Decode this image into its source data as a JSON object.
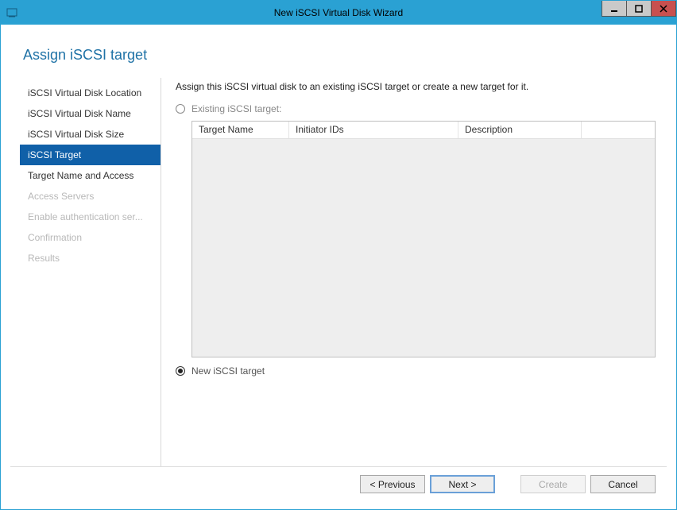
{
  "window": {
    "title": "New iSCSI Virtual Disk Wizard"
  },
  "heading": "Assign iSCSI target",
  "sidebar": {
    "items": [
      {
        "label": "iSCSI Virtual Disk Location",
        "state": "enabled"
      },
      {
        "label": "iSCSI Virtual Disk Name",
        "state": "enabled"
      },
      {
        "label": "iSCSI Virtual Disk Size",
        "state": "enabled"
      },
      {
        "label": "iSCSI Target",
        "state": "selected"
      },
      {
        "label": "Target Name and Access",
        "state": "enabled"
      },
      {
        "label": "Access Servers",
        "state": "disabled"
      },
      {
        "label": "Enable authentication ser...",
        "state": "disabled"
      },
      {
        "label": "Confirmation",
        "state": "disabled"
      },
      {
        "label": "Results",
        "state": "disabled"
      }
    ]
  },
  "main": {
    "instruction": "Assign this iSCSI virtual disk to an existing iSCSI target or create a new target for it.",
    "radio_existing": "Existing iSCSI target:",
    "radio_new": "New iSCSI target",
    "selected_radio": "new",
    "table": {
      "cols": {
        "name": "Target Name",
        "init": "Initiator IDs",
        "desc": "Description"
      }
    }
  },
  "footer": {
    "previous": "< Previous",
    "next": "Next >",
    "create": "Create",
    "cancel": "Cancel"
  }
}
